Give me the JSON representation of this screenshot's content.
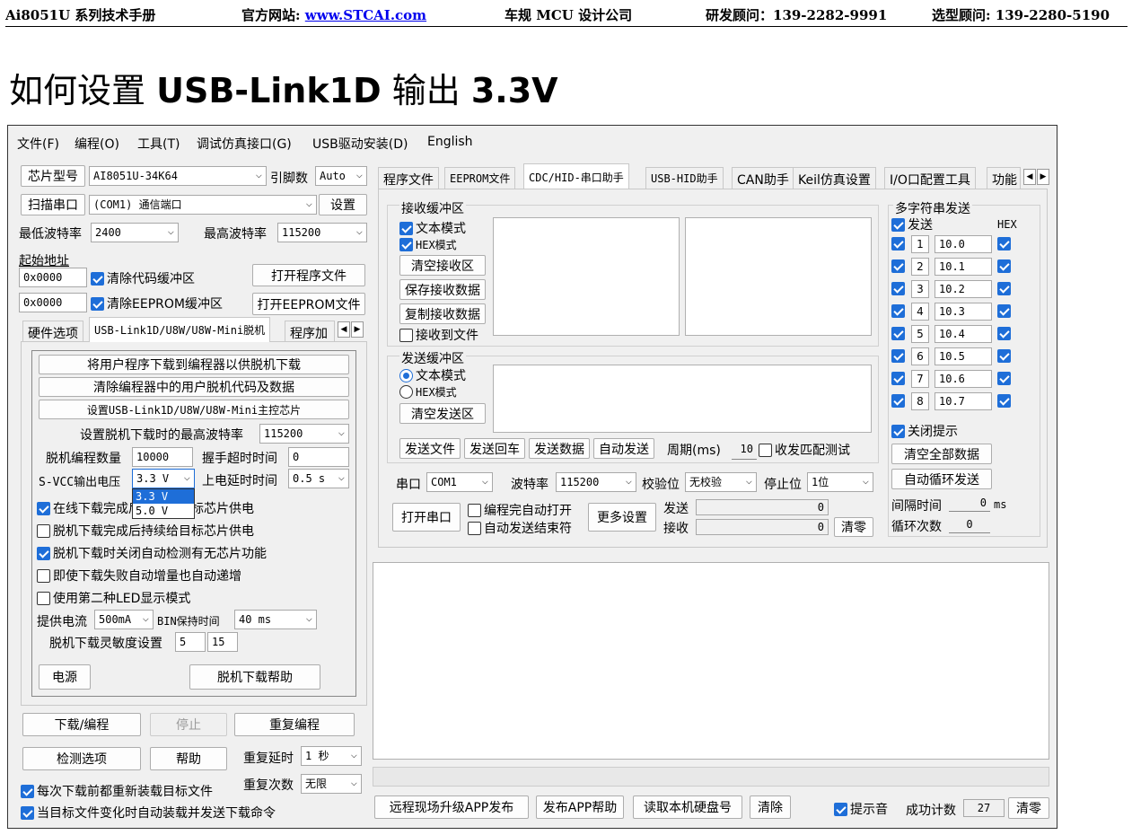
{
  "header": {
    "manual": "Ai8051U 系列技术手册",
    "site_label": "官方网站:",
    "site_url": "www.STCAI.com",
    "company": "车规 MCU 设计公司",
    "rd_contact": "研发顾问：139-2282-9991",
    "sel_contact": "选型顾问: 139-2280-5190"
  },
  "page_title": {
    "prefix": "如何设置",
    "bold": "USB-Link1D",
    "mid": "输出",
    "voltage": "3.3V"
  },
  "menu": [
    "文件(F)",
    "编程(O)",
    "工具(T)",
    "调试仿真接口(G)",
    "USB驱动安装(D)",
    "English"
  ],
  "left": {
    "chip_label": "芯片型号",
    "chip_value": "AI8051U-34K64",
    "pins_label": "引脚数",
    "pins_value": "Auto",
    "scan_port": "扫描串口",
    "port_value": "(COM1) 通信端口",
    "settings": "设置",
    "min_baud_label": "最低波特率",
    "min_baud": "2400",
    "max_baud_label": "最高波特率",
    "max_baud": "115200",
    "start_addr": "起始地址",
    "addr1": "0x0000",
    "clear_code": "清除代码缓冲区",
    "open_prog": "打开程序文件",
    "addr2": "0x0000",
    "clear_eeprom": "清除EEPROM缓冲区",
    "open_eeprom": "打开EEPROM文件",
    "tabs": [
      "硬件选项",
      "USB-Link1D/U8W/U8W-Mini脱机",
      "程序加"
    ],
    "offline": {
      "btn1": "将用户程序下载到编程器以供脱机下载",
      "btn2": "清除编程器中的用户脱机代码及数据",
      "btn3": "设置USB-Link1D/U8W/U8W-Mini主控芯片",
      "max_baud_label": "设置脱机下载时的最高波特率",
      "max_baud": "115200",
      "count_label": "脱机编程数量",
      "count": "10000",
      "handshake_label": "握手超时时间",
      "handshake": "0",
      "svcc_label": "S-VCC输出电压",
      "svcc": "3.3 V",
      "svcc_options": [
        "3.3 V",
        "5.0 V"
      ],
      "delay_label": "上电延时时间",
      "delay": "0.5 s",
      "cb1": "在线下载完成后持续给目标芯片供电",
      "cb2": "脱机下载完成后持续给目标芯片供电",
      "cb3": "脱机下载时关闭自动检测有无芯片功能",
      "cb4": "即使下载失败自动增量也自动递增",
      "cb5": "使用第二种LED显示模式",
      "current_label": "提供电流",
      "current": "500mA",
      "bin_label": "BIN保持时间",
      "bin": "40 ms",
      "sens_label": "脱机下载灵敏度设置",
      "sens1": "5",
      "sens2": "15",
      "power": "电源",
      "help": "脱机下载帮助"
    },
    "download": "下载/编程",
    "stop": "停止",
    "repeat": "重复编程",
    "check": "检测选项",
    "help": "帮助",
    "repeat_delay_label": "重复延时",
    "repeat_delay": "1 秒",
    "repeat_count_label": "重复次数",
    "repeat_count": "无限",
    "reload_cb": "每次下载前都重新装载目标文件",
    "auto_cb": "当目标文件变化时自动装载并发送下载命令"
  },
  "right": {
    "tabs": [
      "程序文件",
      "EEPROM文件",
      "CDC/HID-串口助手",
      "USB-HID助手",
      "CAN助手",
      "Keil仿真设置",
      "I/O口配置工具",
      "功能"
    ],
    "recv": {
      "title": "接收缓冲区",
      "text_mode": "文本模式",
      "hex_mode": "HEX模式",
      "clear": "清空接收区",
      "save": "保存接收数据",
      "copy": "复制接收数据",
      "to_file": "接收到文件"
    },
    "send": {
      "title": "发送缓冲区",
      "text_mode": "文本模式",
      "hex_mode": "HEX模式",
      "clear": "清空发送区",
      "send_file": "发送文件",
      "send_cr": "发送回车",
      "send_data": "发送数据",
      "auto_send": "自动发送",
      "period_label": "周期(ms)",
      "period": "10",
      "match": "收发匹配测试"
    },
    "port_label": "串口",
    "port": "COM1",
    "baud_label": "波特率",
    "baud": "115200",
    "parity_label": "校验位",
    "parity": "无校验",
    "stop_label": "停止位",
    "stop": "1位",
    "open_port": "打开串口",
    "auto_open": "编程完自动打开",
    "auto_end": "自动发送结束符",
    "more": "更多设置",
    "sent_label": "发送",
    "sent": "0",
    "recv_label": "接收",
    "recv_count": "0",
    "clear": "清零",
    "multi": {
      "title": "多字符串发送",
      "send": "发送",
      "hex": "HEX",
      "rows": [
        {
          "n": "1",
          "v": "10.0"
        },
        {
          "n": "2",
          "v": "10.1"
        },
        {
          "n": "3",
          "v": "10.2"
        },
        {
          "n": "4",
          "v": "10.3"
        },
        {
          "n": "5",
          "v": "10.4"
        },
        {
          "n": "6",
          "v": "10.5"
        },
        {
          "n": "7",
          "v": "10.6"
        },
        {
          "n": "8",
          "v": "10.7"
        }
      ],
      "close_hint": "关闭提示",
      "clear_all": "清空全部数据",
      "loop": "自动循环发送",
      "interval_label": "间隔时间",
      "interval": "0",
      "ms": "ms",
      "loops_label": "循环次数",
      "loops": "0"
    },
    "bottom": {
      "remote": "远程现场升级APP发布",
      "app_help": "发布APP帮助",
      "disk": "读取本机硬盘号",
      "clear": "清除",
      "beep": "提示音",
      "success_label": "成功计数",
      "success": "27",
      "reset": "清零"
    }
  },
  "colors": {
    "accent": "#1e6ed8",
    "window_bg": "#f0f0f0"
  }
}
